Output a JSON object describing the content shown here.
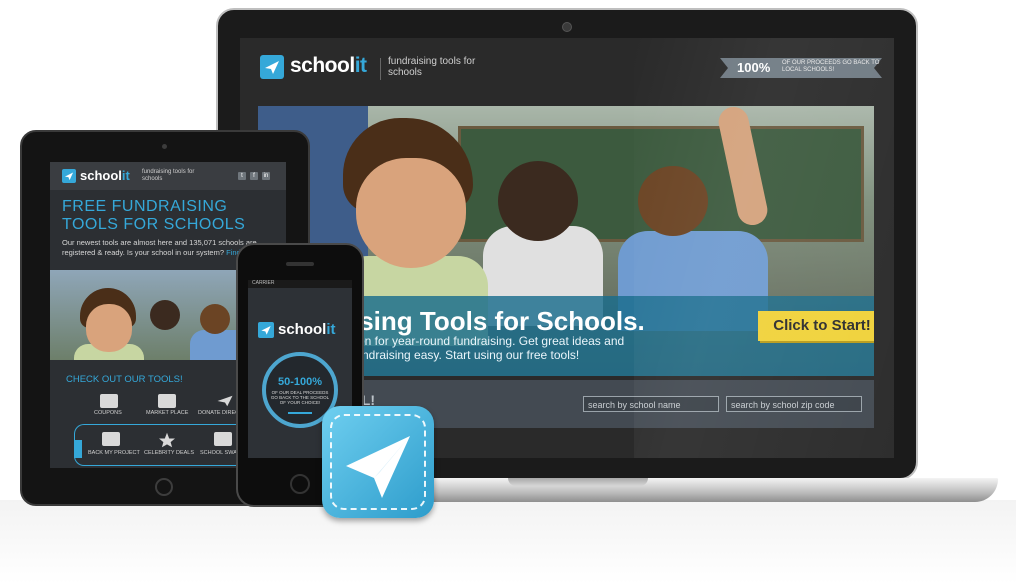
{
  "laptop": {
    "brand": {
      "name_main": "school",
      "name_accent": "it",
      "tagline": "fundraising tools for schools"
    },
    "ribbon": {
      "percent": "100%",
      "text": "of our proceeds go back to local schools!"
    },
    "hero": {
      "title": "ising Tools for Schools.",
      "line1": "tion for year-round fundraising. Get great ideas and",
      "line2": "fundraising easy. Start using our free tools!",
      "cta": "Click to Start!"
    },
    "search": {
      "label": "OOL!",
      "name_placeholder": "search by school name",
      "zip_placeholder": "search by school zip code"
    }
  },
  "tablet": {
    "brand": {
      "name_main": "school",
      "name_accent": "it",
      "tagline": "fundraising tools for schools"
    },
    "social": [
      "t",
      "f",
      "in"
    ],
    "title_line1": "FREE FUNDRAISING",
    "title_line2": "TOOLS FOR SCHOOLS",
    "desc_line1": "Our newest tools are almost here and 135,071 schools are",
    "desc_line2": "registered & ready. Is your school in our system?",
    "desc_link": "Find",
    "check_heading": "CHECK OUT OUR TOOLS!",
    "tools_row1": [
      "COUPONS",
      "MARKET PLACE",
      "DONATE DIRECT"
    ],
    "tools_row2": [
      "BACK MY PROJECT",
      "CELEBRITY DEALS",
      "SCHOOL SWAG"
    ]
  },
  "phone": {
    "carrier": "CARRIER",
    "brand": {
      "name_main": "school",
      "name_accent": "it"
    },
    "percent": "50-100%",
    "note": "of our deal proceeds go back to the school of your choice!"
  },
  "colors": {
    "accent": "#35a8d9",
    "cta": "#f0d23a",
    "dark": "#2a2a2a"
  },
  "icons": [
    "paper-plane-icon",
    "camera-icon",
    "home-button-icon"
  ]
}
